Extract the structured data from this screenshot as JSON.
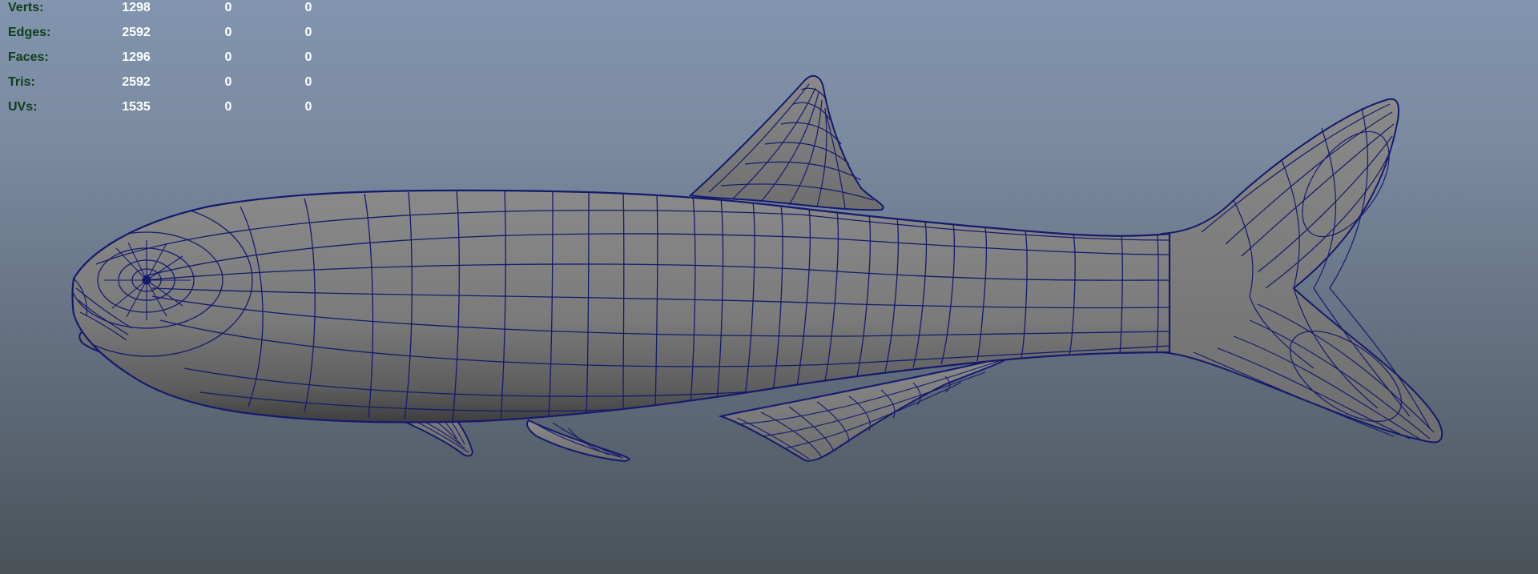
{
  "viewport": {
    "stats": [
      {
        "label": "Verts:",
        "values": [
          "1298",
          "0",
          "0"
        ]
      },
      {
        "label": "Edges:",
        "values": [
          "2592",
          "0",
          "0"
        ]
      },
      {
        "label": "Faces:",
        "values": [
          "1296",
          "0",
          "0"
        ]
      },
      {
        "label": "Tris:",
        "values": [
          "2592",
          "0",
          "0"
        ]
      },
      {
        "label": "UVs:",
        "values": [
          "1535",
          "0",
          "0"
        ]
      }
    ],
    "colors": {
      "wireframe": "#141a6e",
      "mesh_fill": "#7a7a7a",
      "label_text": "#0d3e18",
      "value_text": "#ffffff"
    }
  }
}
